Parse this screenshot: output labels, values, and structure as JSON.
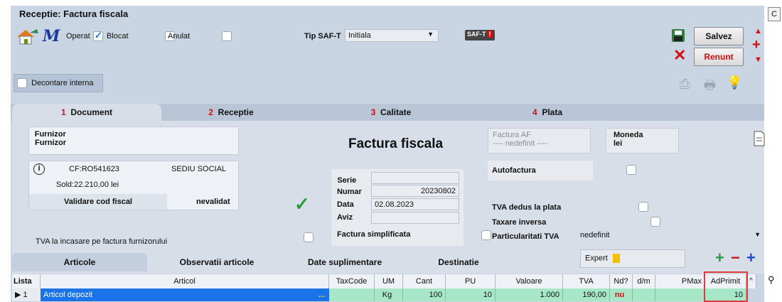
{
  "window": {
    "title": "Receptie: Factura fiscala",
    "edge_button": "C"
  },
  "toolbar": {
    "operat_label": "Operat",
    "operat_checked": true,
    "blocat_label": "Blocat",
    "blocat_checked": false,
    "anulat_label": "Anulat",
    "anulat_checked": false,
    "tip_saft_label": "Tip SAF-T",
    "tip_saft_value": "Initiala",
    "saft_badge": "SAF-T",
    "salvez_label": "Salvez",
    "renunt_label": "Renunt",
    "decontare_label": "Decontare interna",
    "decontare_checked": false
  },
  "tabs": [
    {
      "num": "1",
      "label": "Document",
      "active": true
    },
    {
      "num": "2",
      "label": "Receptie",
      "active": false
    },
    {
      "num": "3",
      "label": "Calitate",
      "active": false
    },
    {
      "num": "4",
      "label": "Plata",
      "active": false
    }
  ],
  "furnizor": {
    "heading1": "Furnizor",
    "heading2": "Furnizor",
    "cf": "CF:RO541623",
    "sediu": "SEDIU SOCIAL",
    "sold": "Sold:22.210,00 lei",
    "validare_label": "Validare cod fiscal",
    "validare_status": "nevalidat"
  },
  "document": {
    "title": "Factura fiscala",
    "serie_label": "Serie",
    "serie_value": "",
    "numar_label": "Numar",
    "numar_value": "20230802",
    "data_label": "Data",
    "data_value": "02.08.2023",
    "aviz_label": "Aviz",
    "aviz_value": "",
    "simplificata_label": "Factura simplificata"
  },
  "factura_af": {
    "label": "Factura AF",
    "value": "---- nedefinit ----"
  },
  "moneda": {
    "label": "Moneda",
    "value": "lei"
  },
  "right_options": {
    "autofactura": "Autofactura",
    "tva_dedus": "TVA dedus la plata",
    "taxare_inversa": "Taxare inversa",
    "particularitati_label": "Particularitati TVA",
    "particularitati_value": "nedefinit"
  },
  "tva_incasare_label": "TVA la incasare pe factura furnizorului",
  "subtabs": [
    "Articole",
    "Observatii articole",
    "Date suplimentare",
    "Destinatie"
  ],
  "expert_label": "Expert",
  "grid": {
    "headers": [
      "Lista",
      "Articol",
      "TaxCode",
      "UM",
      "Cant",
      "PU",
      "Valoare",
      "TVA",
      "Nd?",
      "d/m",
      "PMax",
      "AdPrimit"
    ],
    "row": {
      "lista": "1",
      "articol": "Articol depozit",
      "ellipsis": "...",
      "taxcode": "",
      "um": "Kg",
      "cant": "100",
      "pu": "10",
      "valoare": "1.000",
      "tva": "190,00",
      "nd": "nu",
      "dm": "",
      "pmax": "",
      "adprimit": "10"
    }
  },
  "colors": {
    "accent_red": "#d01010",
    "row_green": "#a8e6c8",
    "panel_bg": "#d7dee8",
    "header_bg": "#c9d5e3"
  }
}
